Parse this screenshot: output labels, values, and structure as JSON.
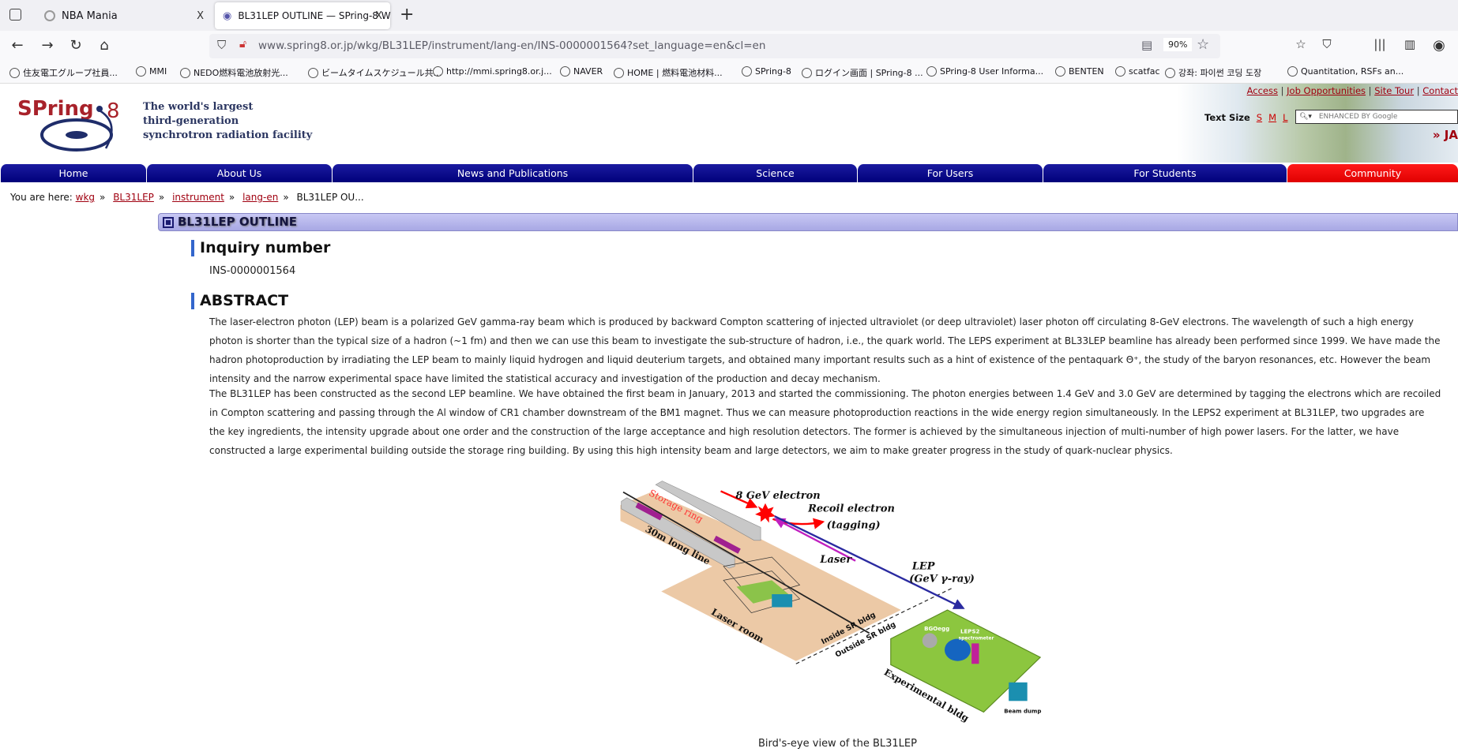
{
  "browser": {
    "tabs": [
      {
        "label": "NBA Mania"
      },
      {
        "label": "BL31LEP OUTLINE — SPring-8 W"
      }
    ],
    "url": "www.spring8.or.jp/wkg/BL31LEP/instrument/lang-en/INS-0000001564?set_language=en&cl=en",
    "zoom": "90%",
    "bookmarks": [
      "住友電工グループ社員...",
      "MMI",
      "NEDO燃料電池放射光...",
      "ビームタイムスケジュール共...",
      "http://mmi.spring8.or.j...",
      "NAVER",
      "HOME | 燃料電池材料...",
      "SPring-8",
      "ログイン画面 | SPring-8 ...",
      "SPring-8 User Informa...",
      "BENTEN",
      "scatfac",
      "강좌: 파이썬 코딩 도장",
      "Quantitation, RSFs an..."
    ]
  },
  "header": {
    "logo": "SPring-8",
    "tagline": [
      "The world's largest",
      "third-generation",
      "synchrotron radiation facility"
    ],
    "toplinks": [
      "Access",
      "Job Opportunities",
      "Site Tour",
      "Contact"
    ],
    "text_size_label": "Text Size",
    "text_sizes": [
      "S",
      "M",
      "L"
    ],
    "search_placeholder": "ENHANCED BY Google",
    "lang_link": "» JA"
  },
  "nav": [
    "Home",
    "About Us",
    "News and Publications",
    "Science",
    "For Users",
    "For Students",
    "Community"
  ],
  "breadcrumb": {
    "prefix": "You are here:",
    "items": [
      "wkg",
      "BL31LEP",
      "instrument",
      "lang-en"
    ],
    "current": "BL31LEP OU..."
  },
  "section_title": "BL31LEP OUTLINE",
  "inquiry": {
    "heading": "Inquiry number",
    "value": "INS-0000001564"
  },
  "abstract": {
    "heading": "ABSTRACT",
    "p1": "The laser-electron photon (LEP) beam is a polarized GeV gamma-ray beam which is produced by backward Compton scattering of injected ultraviolet (or deep ultraviolet) laser photon off circulating 8-GeV electrons. The wavelength of such a high energy\nphoton is shorter than the typical size of a hadron (~1 fm) and then we can use this beam to investigate the sub-structure of hadron, i.e., the quark world. The LEPS experiment at BL33LEP beamline has already been performed since 1999. We have made the\nhadron photoproduction by irradiating the LEP beam to mainly liquid hydrogen and liquid deuterium targets, and obtained many important results such as a hint of existence of the pentaquark Θ⁺, the study of the baryon resonances, etc. However the beam\nintensity and the narrow experimental space have limited the statistical accuracy and investigation of the production and decay mechanism.",
    "p2": "The BL31LEP has been constructed as the second LEP beamline. We have obtained the first beam in January, 2013 and started the commissioning. The photon energies between 1.4 GeV and 3.0 GeV are determined by tagging the electrons which are recoiled\nin Compton scattering and passing through the Al window of CR1 chamber downstream of the BM1 magnet. Thus we can measure photoproduction reactions in the wide energy region simultaneously. In the LEPS2 experiment at BL31LEP, two upgrades are\nthe key ingredients, the intensity upgrade about one order and the construction of the large acceptance and high resolution detectors. The former is achieved by the simultaneous injection of multi-number of high power lasers. For the latter, we have\nconstructed a large experimental building outside the storage ring building. By using this high intensity beam and large detectors, we aim to make greater progress in the study of quark-nuclear physics."
  },
  "figure": {
    "labels": {
      "electron": "8 GeV electron",
      "recoil": "Recoil electron",
      "tagging": "(tagging)",
      "laser": "Laser",
      "lep": "LEP",
      "lep_sub": "(GeV γ-ray)",
      "storage": "Storage ring",
      "longline": "30m long line",
      "laserroom": "Laser room",
      "inside": "Inside SR bldg",
      "outside": "Outside SR bldg",
      "bgo": "BGOegg",
      "leps2": "LEPS2",
      "spectrometer": "spectrometer",
      "expbldg": "Experimental bldg",
      "beamdump": "Beam dump"
    },
    "caption": "Bird's-eye view of the BL31LEP"
  },
  "colors": {
    "nav": "#00007a",
    "community": "#ff0000",
    "link": "#a00010"
  }
}
